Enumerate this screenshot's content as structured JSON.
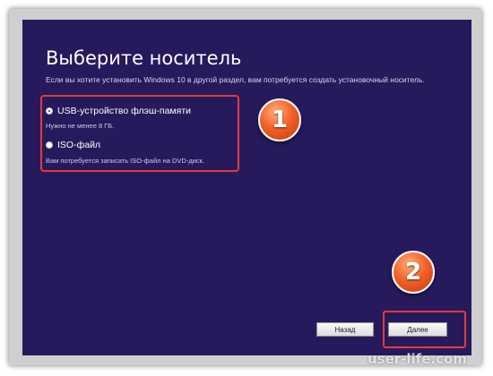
{
  "page": {
    "title": "Выберите носитель",
    "subtitle": "Если вы хотите установить Windows 10 в другой раздел, вам потребуется создать установочный носитель."
  },
  "options": [
    {
      "label": "USB-устройство флэш-памяти",
      "description": "Нужно не менее 8 ГБ.",
      "selected": true
    },
    {
      "label": "ISO-файл",
      "description": "Вам потребуется записать ISO-файл на DVD-диск.",
      "selected": false
    }
  ],
  "markers": [
    "1",
    "2"
  ],
  "buttons": {
    "back_label": "Назад",
    "next_label": "Далее"
  },
  "watermark": "user-life.com",
  "colors": {
    "panel_background": "#271a5c",
    "highlight": "#e23a3a",
    "marker": "#f2622a"
  }
}
